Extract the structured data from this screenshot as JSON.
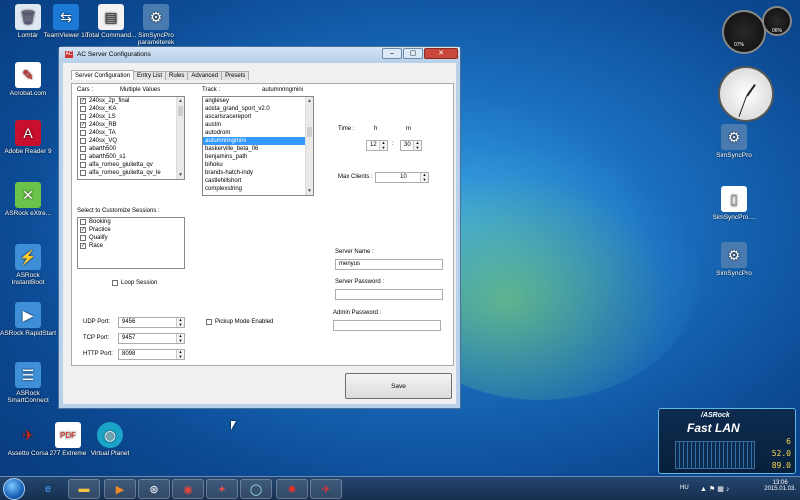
{
  "desktop_icons": [
    {
      "id": "lomtar",
      "label": "Lomtár",
      "icon": "recycle-bin-icon",
      "color": "#dfe8f0"
    },
    {
      "id": "teamviewer",
      "label": "TeamViewer 10",
      "icon": "teamviewer-icon",
      "color": "#1c7ad6"
    },
    {
      "id": "totalcmd",
      "label": "Total Command...",
      "icon": "total-commander-icon",
      "color": "#f3f3f3"
    },
    {
      "id": "simsyncpro-top",
      "label": "SimSyncPro paraméterek",
      "icon": "simsync-icon",
      "color": "#4a7bb0"
    },
    {
      "id": "acrobat",
      "label": "Acrobat.com",
      "icon": "acrobat-icon",
      "color": "#ffffff"
    },
    {
      "id": "adobereader",
      "label": "Adobe Reader 9",
      "icon": "adobe-reader-icon",
      "color": "#c8102e"
    },
    {
      "id": "asrock-extreme",
      "label": "ASRock eXtre...",
      "icon": "asrock-extreme-icon",
      "color": "#6cc24a"
    },
    {
      "id": "asrock-instantboot",
      "label": "ASRock InstantBoot",
      "icon": "asrock-instantboot-icon",
      "color": "#3f8fd8"
    },
    {
      "id": "asrock-rapidstart",
      "label": "ASRock RapidStart",
      "icon": "asrock-rapidstart-icon",
      "color": "#3f8fd8"
    },
    {
      "id": "asrock-smartconnect",
      "label": "ASRock SmartConnect",
      "icon": "asrock-smartconnect-icon",
      "color": "#3f8fd8"
    },
    {
      "id": "assetto",
      "label": "Assetto Corsa",
      "icon": "assetto-corsa-icon",
      "color": "#d9261c"
    },
    {
      "id": "extreme277",
      "label": "277 Extreme",
      "icon": "pdf-icon",
      "color": "#d9261c"
    },
    {
      "id": "virtualplanet",
      "label": "Virtual Planet",
      "icon": "globe-icon",
      "color": "#1aa4c8"
    },
    {
      "id": "simsyncpro-right1",
      "label": "SimSyncPro",
      "icon": "simsync-icon",
      "color": "#4a7bb0"
    },
    {
      "id": "simsyncpro-right2",
      "label": "SimSyncPro....",
      "icon": "file-icon",
      "color": "#ffffff"
    },
    {
      "id": "simsyncpro-right3",
      "label": "SimSyncPro",
      "icon": "simsync-icon",
      "color": "#4a7bb0"
    }
  ],
  "window": {
    "title": "AC Server Configurations",
    "tabs": [
      "Server Configuration",
      "Entry List",
      "Rules",
      "Advanced",
      "Presets"
    ],
    "cars": {
      "label": "Cars :",
      "multiple_values_label": "Multiple Values",
      "items": [
        {
          "name": "240sx_2p_final",
          "checked": true
        },
        {
          "name": "240sx_KA",
          "checked": false
        },
        {
          "name": "240sx_LS",
          "checked": false
        },
        {
          "name": "240sx_RB",
          "checked": true
        },
        {
          "name": "240sx_TA",
          "checked": false
        },
        {
          "name": "240sx_VQ",
          "checked": false
        },
        {
          "name": "abarth500",
          "checked": false
        },
        {
          "name": "abarth500_s1",
          "checked": false
        },
        {
          "name": "alfa_romeo_giulietta_qv",
          "checked": false
        },
        {
          "name": "alfa_romeo_giulietta_qv_le",
          "checked": false
        }
      ]
    },
    "track": {
      "label": "Track :",
      "selected_label": "autumnringmini",
      "items": [
        "anglesey",
        "aosta_grand_sport_v2.0",
        "ascarisracereport",
        "austin",
        "autodrom",
        "autumnringmini",
        "baskerville_beta_06",
        "benjamins_path",
        "bihoku",
        "brands-hatch-indy",
        "castlehillshort",
        "complexstring"
      ],
      "selected_index": 5
    },
    "time": {
      "label": "Time :",
      "h_label": "h",
      "m_label": "m",
      "hours": "12",
      "minutes": "30",
      "separator": ":"
    },
    "max_clients": {
      "label": "Max Clients :",
      "value": "10"
    },
    "sessions": {
      "label": "Select to Customize Sessions :",
      "items": [
        {
          "name": "Booking",
          "checked": false
        },
        {
          "name": "Practice",
          "checked": true
        },
        {
          "name": "Qualify",
          "checked": false
        },
        {
          "name": "Race",
          "checked": true
        }
      ]
    },
    "loop_session": {
      "label": "Loop Session",
      "checked": false
    },
    "pickup_mode": {
      "label": "Pickup Mode Enabled",
      "checked": false
    },
    "ports": [
      {
        "label": "UDP Port:",
        "value": "9456"
      },
      {
        "label": "TCP Port:",
        "value": "9457"
      },
      {
        "label": "HTTP Port:",
        "value": "8098"
      }
    ],
    "server_name": {
      "label": "Server Name :",
      "value": "menyus"
    },
    "server_password": {
      "label": "Server Password :",
      "value": ""
    },
    "admin_password": {
      "label": "Admin Password :",
      "value": ""
    },
    "save_label": "Save"
  },
  "gadgets": {
    "cpu_meter": {
      "cpu_percent": "07%",
      "ram_percent": "06%"
    },
    "fast_lan": {
      "brand": "/ASRock",
      "title": "Fast LAN",
      "values": [
        "6",
        "52.0",
        "89.0"
      ]
    }
  },
  "taskbar": {
    "items": [
      "internet-explorer-icon",
      "explorer-folder-icon",
      "media-player-icon",
      "steam-icon",
      "chrome-icon",
      "sim-app-icon",
      "circle-app-icon",
      "red-app-icon",
      "assetto-corsa-icon"
    ],
    "language": "HU",
    "time": "13:06",
    "date": "2015.01.03."
  }
}
